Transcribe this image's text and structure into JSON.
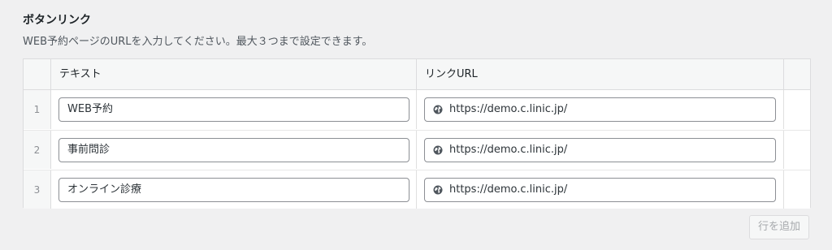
{
  "section": {
    "title": "ボタンリンク",
    "description": "WEB予約ページのURLを入力してください。最大３つまで設定できます。"
  },
  "table": {
    "headers": {
      "text": "テキスト",
      "url": "リンクURL"
    },
    "rows": [
      {
        "index": "1",
        "text": "WEB予約",
        "url": "https://demo.c.linic.jp/"
      },
      {
        "index": "2",
        "text": "事前問診",
        "url": "https://demo.c.linic.jp/"
      },
      {
        "index": "3",
        "text": "オンライン診療",
        "url": "https://demo.c.linic.jp/"
      }
    ]
  },
  "actions": {
    "add_row_label": "行を追加"
  },
  "icons": {
    "url_field": "globe-icon"
  }
}
